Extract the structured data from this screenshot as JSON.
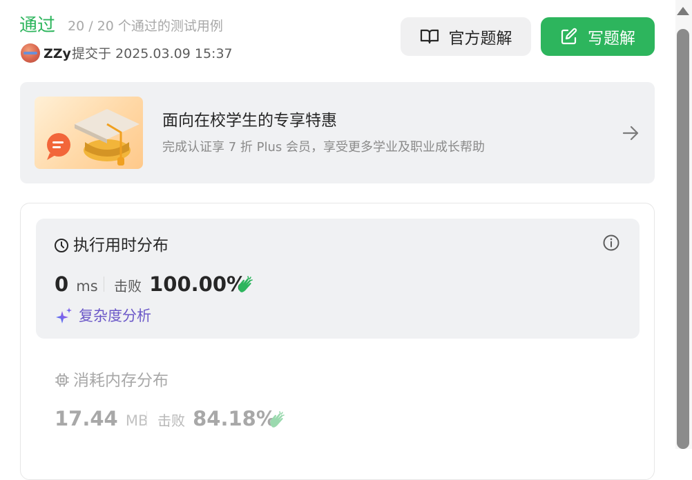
{
  "header": {
    "status": "通过",
    "cases": "20 / 20 个通过的测试用例",
    "user": "ZZy",
    "submitted": "提交于 2025.03.09 15:37"
  },
  "buttons": {
    "official_solution": "官方题解",
    "write_solution": "写题解"
  },
  "promo": {
    "title": "面向在校学生的专享特惠",
    "subtitle": "完成认证享 7 折 Plus 会员，享受更多学业及职业成长帮助"
  },
  "runtime": {
    "title": "执行用时分布",
    "value": "0",
    "unit": "ms",
    "beat_label": "击败",
    "beat_value": "100.00%",
    "complexity_link": "复杂度分析"
  },
  "memory": {
    "title": "消耗内存分布",
    "value": "17.44",
    "unit": "MB",
    "beat_label": "击败",
    "beat_value": "84.18%"
  },
  "colors": {
    "accent_green": "#2db55d",
    "complexity_purple": "#6b58c8"
  },
  "icons": {
    "book": "book-icon",
    "edit": "edit-icon",
    "arrow": "arrow-right-icon",
    "clock": "clock-icon",
    "info": "info-icon",
    "clap": "clap-icon",
    "sparkle": "sparkle-icon",
    "chip": "chip-icon"
  }
}
